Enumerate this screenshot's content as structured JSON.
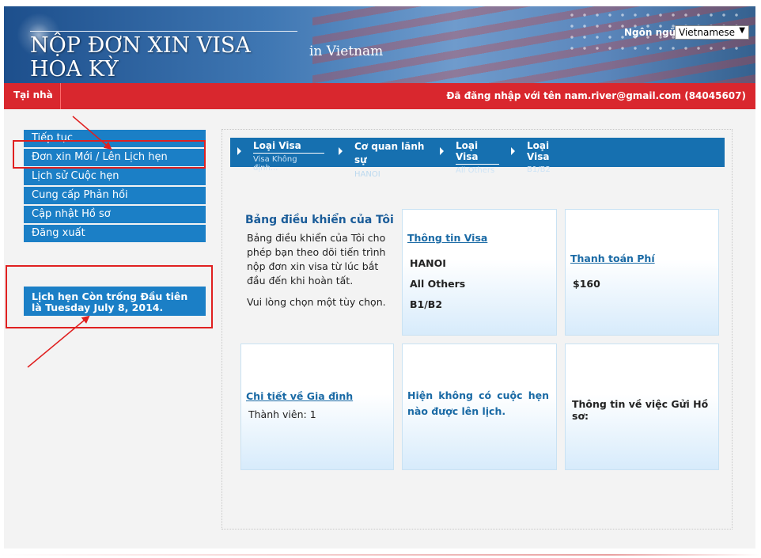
{
  "header": {
    "title": "NỘP ĐƠN XIN VISA HOA KỲ",
    "subtitle": "in Vietnam",
    "language_label": "Ngôn ngữ:",
    "language_value": "Vietnamese",
    "language_arrow": "▼"
  },
  "navbar": {
    "home_label": "Tại nhà",
    "login_text": "Đã đăng nhập với tên  nam.river@gmail.com (84045607)"
  },
  "sidebar": {
    "items": [
      {
        "label": "Tiếp tục"
      },
      {
        "label": "Đơn xin Mới / Lên Lịch hẹn"
      },
      {
        "label": "Lịch sử Cuộc hẹn"
      },
      {
        "label": "Cung cấp Phản hồi"
      },
      {
        "label": "Cập nhật Hồ sơ"
      },
      {
        "label": "Đăng xuất"
      }
    ],
    "appointment_notice": "Lịch hẹn Còn trống Đầu tiên là Tuesday July 8, 2014."
  },
  "breadcrumbs": [
    {
      "title": "Loại Visa",
      "sub": "Visa Không định..."
    },
    {
      "title": "Cơ quan lãnh sự",
      "sub": "HANOI"
    },
    {
      "title": "Loại Visa",
      "sub": "All Others"
    },
    {
      "title": "Loại Visa",
      "sub": "B1/B2"
    }
  ],
  "dashboard": {
    "title": "Bảng điều khiển của Tôi",
    "description": "Bảng điều khiển của Tôi cho phép bạn theo dõi tiến trình nộp đơn xin visa từ lúc bắt đầu đến khi hoàn tất.",
    "instruction": "Vui lòng chọn một tùy chọn."
  },
  "cards": {
    "visa_info": {
      "link": "Thông tin Visa",
      "values": [
        "HANOI",
        "All Others",
        "B1/B2"
      ]
    },
    "fee": {
      "link": "Thanh toán Phí",
      "value": "$160"
    },
    "family": {
      "link": "Chi tiết về Gia đình",
      "value": "Thành viên: 1"
    },
    "appointment": {
      "text": "Hiện không có cuộc hẹn nào được lên lịch."
    },
    "documents": {
      "text": "Thông tin về việc Gửi Hồ sơ:"
    }
  },
  "annotation_color": "#e02020",
  "accent_blue": "#1b7fc6",
  "nav_red": "#d9272e"
}
